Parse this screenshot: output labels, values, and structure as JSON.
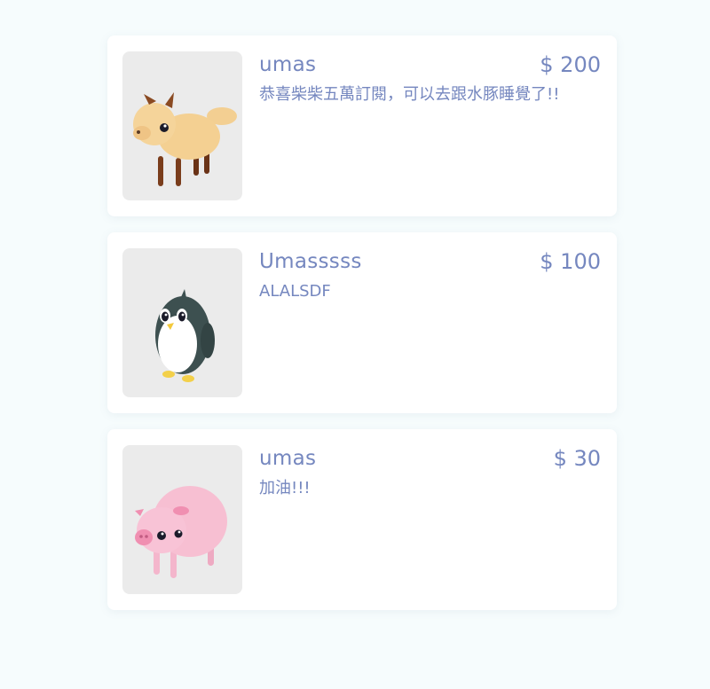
{
  "donations": [
    {
      "name": "umas",
      "amount": "$ 200",
      "message": "恭喜柴柴五萬訂閱，可以去跟水豚睡覺了!!",
      "avatar_icon": "deer-icon"
    },
    {
      "name": "Umasssss",
      "amount": "$ 100",
      "message": "ALALSDF",
      "avatar_icon": "penguin-icon"
    },
    {
      "name": "umas",
      "amount": "$ 30",
      "message": "加油!!!",
      "avatar_icon": "pig-icon"
    }
  ],
  "colors": {
    "text": "#7587bf",
    "card": "#ffffff",
    "background": "#f6fcfd",
    "thumb": "#ebebeb"
  }
}
